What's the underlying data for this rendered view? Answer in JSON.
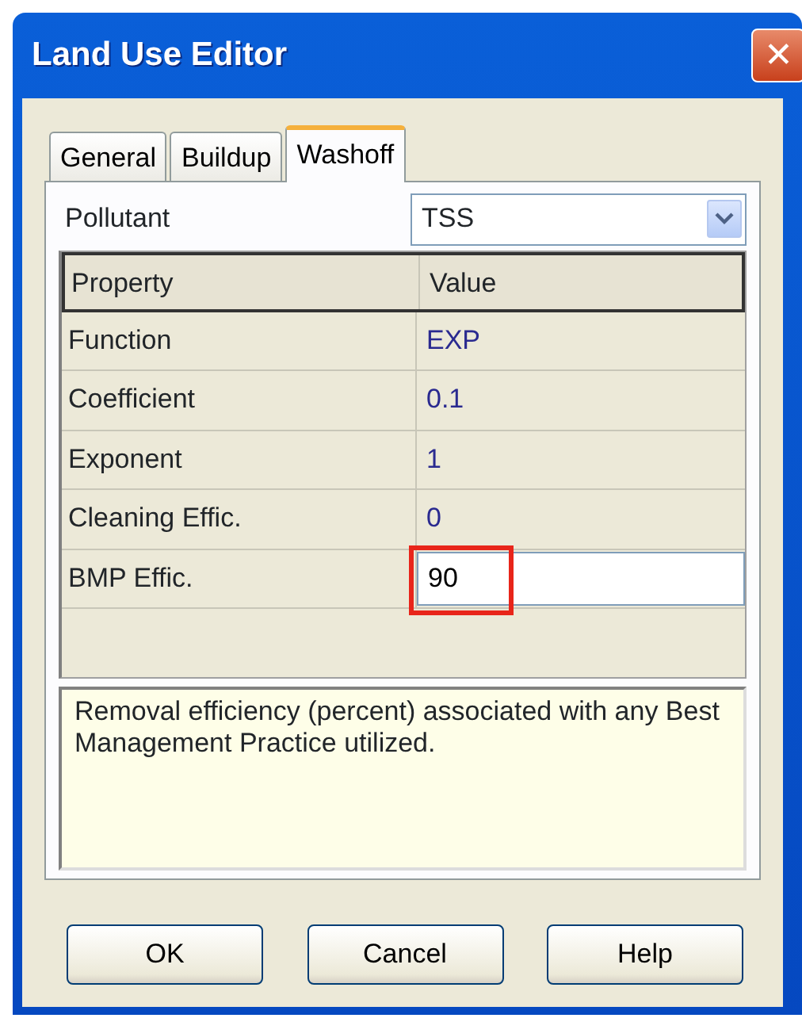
{
  "window": {
    "title": "Land Use Editor",
    "close": "✕"
  },
  "tabs": [
    {
      "label": "General",
      "selected": false
    },
    {
      "label": "Buildup",
      "selected": false
    },
    {
      "label": "Washoff",
      "selected": true
    }
  ],
  "pollutant": {
    "label": "Pollutant",
    "value": "TSS"
  },
  "grid": {
    "columns": [
      "Property",
      "Value"
    ],
    "rows": [
      {
        "property": "Function",
        "value": "EXP",
        "editing": false,
        "highlighted": false
      },
      {
        "property": "Coefficient",
        "value": "0.1",
        "editing": false,
        "highlighted": false
      },
      {
        "property": "Exponent",
        "value": "1",
        "editing": false,
        "highlighted": false
      },
      {
        "property": "Cleaning Effic.",
        "value": "0",
        "editing": false,
        "highlighted": false
      },
      {
        "property": "BMP Effic.",
        "value": "90",
        "editing": true,
        "highlighted": true
      }
    ]
  },
  "description": "Removal efficiency (percent) associated with any Best Management Practice utilized.",
  "buttons": [
    "OK",
    "Cancel",
    "Help"
  ]
}
